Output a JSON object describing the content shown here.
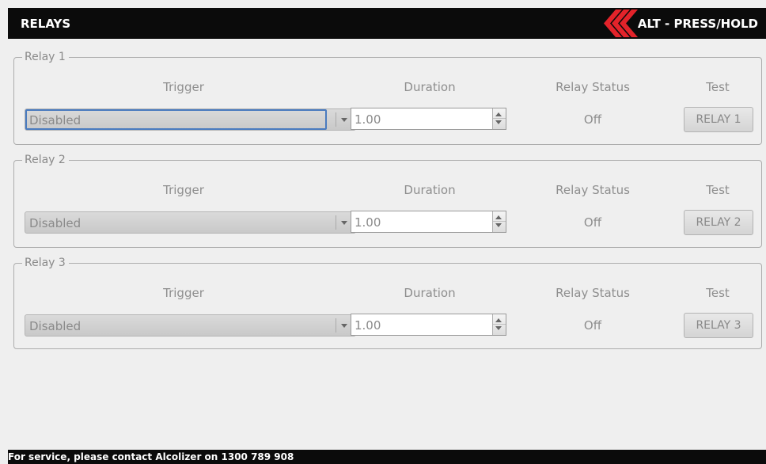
{
  "header": {
    "title": "RELAYS",
    "alt_label": "ALT - PRESS/HOLD",
    "accent_color": "#e3232a"
  },
  "columns": {
    "trigger": "Trigger",
    "duration": "Duration",
    "status": "Relay Status",
    "test": "Test"
  },
  "relays": [
    {
      "name": "Relay 1",
      "trigger": "Disabled",
      "duration": "1.00",
      "status": "Off",
      "test_label": "RELAY 1",
      "focused": true
    },
    {
      "name": "Relay 2",
      "trigger": "Disabled",
      "duration": "1.00",
      "status": "Off",
      "test_label": "RELAY 2",
      "focused": false
    },
    {
      "name": "Relay 3",
      "trigger": "Disabled",
      "duration": "1.00",
      "status": "Off",
      "test_label": "RELAY 3",
      "focused": false
    }
  ],
  "footer": {
    "text": "For service, please contact Alcolizer on 1300 789 908"
  },
  "icons": {
    "brand": "chevron-logo-icon",
    "dropdown": "chevron-down-icon",
    "spin_up": "spin-up-icon",
    "spin_down": "spin-down-icon"
  }
}
